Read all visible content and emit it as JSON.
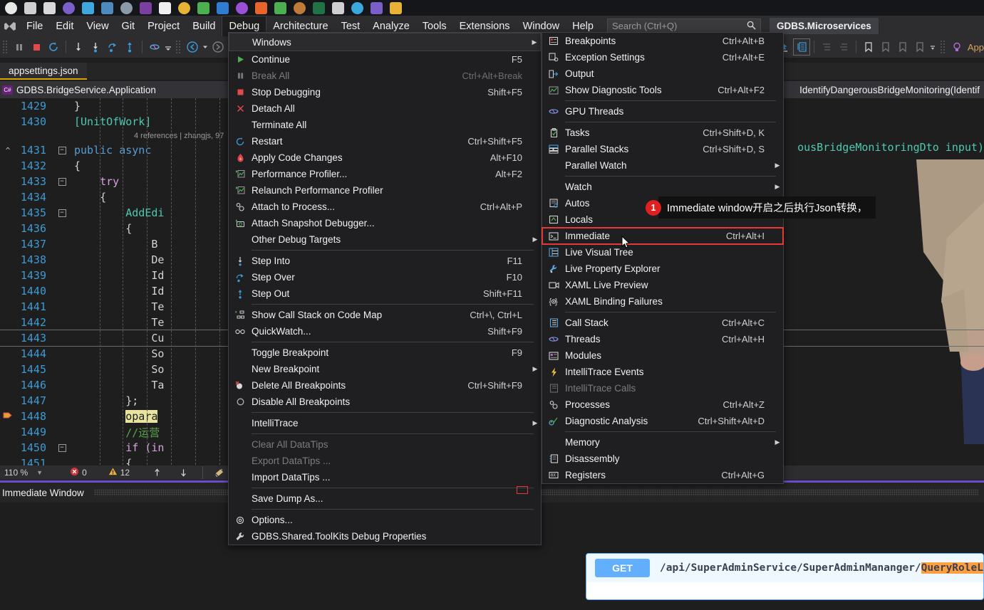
{
  "taskbar": {
    "icons": [
      {
        "name": "windows-start-icon",
        "color": "#e8e8e8"
      },
      {
        "name": "wrench-icon",
        "color": "#cfcfcf"
      },
      {
        "name": "ball-icon",
        "color": "#d8d8d8"
      },
      {
        "name": "navicat-icon",
        "color": "#7b5ec7"
      },
      {
        "name": "browser-icon",
        "color": "#3fa7dd"
      },
      {
        "name": "python-icon",
        "color": "#4b8bbe"
      },
      {
        "name": "explorer-icon",
        "color": "#8a9aa8"
      },
      {
        "name": "viber-icon",
        "color": "#7b3fa0"
      },
      {
        "name": "notepad-icon",
        "color": "#f0f0f0"
      },
      {
        "name": "fileman-icon",
        "color": "#e8b335"
      },
      {
        "name": "chrome-icon",
        "color": "#4caf50"
      },
      {
        "name": "vscode-icon",
        "color": "#2f7dd1"
      },
      {
        "name": "visualstudio-icon",
        "color": "#9b4fd6"
      },
      {
        "name": "firefox-icon",
        "color": "#e8642a"
      },
      {
        "name": "wechat-icon",
        "color": "#4cb050"
      },
      {
        "name": "photo-icon",
        "color": "#c07a3a"
      },
      {
        "name": "excel-icon",
        "color": "#217346"
      },
      {
        "name": "disc-icon",
        "color": "#cfcfcf"
      },
      {
        "name": "azure-icon",
        "color": "#3ba8dd"
      },
      {
        "name": "app-icon",
        "color": "#7b5ec7"
      },
      {
        "name": "opera-icon",
        "color": "#e8b335"
      }
    ]
  },
  "menubar": {
    "items": [
      "File",
      "Edit",
      "View",
      "Git",
      "Project",
      "Build",
      "Debug",
      "Architecture",
      "Test",
      "Analyze",
      "Tools",
      "Extensions",
      "Window",
      "Help"
    ],
    "active": "Debug",
    "search_placeholder": "Search (Ctrl+Q)",
    "solution_title": "GDBS.Microservices"
  },
  "editor": {
    "tab_label": "appsettings.json",
    "breadcrumb_class": "GDBS.BridgeService.Application",
    "breadcrumb_member": "IdentifyDangerousBridgeMonitoring(Identif",
    "cs_badge": "C#",
    "reference_info": "4 references | zhangjs, 97",
    "lines": [
      {
        "no": "1429",
        "code": "}",
        "indent": 3,
        "fold": ""
      },
      {
        "no": "1430",
        "code": "[UnitOfWork]",
        "indent": 3,
        "fold": "",
        "cls": "attr"
      },
      {
        "no": "",
        "code": "4 references | zhangjs, 97",
        "ref": true
      },
      {
        "no": "1431",
        "code": "public async ",
        "indent": 3,
        "fold": "-",
        "kw": true,
        "marker": "^"
      },
      {
        "no": "1432",
        "code": "{",
        "indent": 3,
        "fold": ""
      },
      {
        "no": "1433",
        "code": "try",
        "indent": 4,
        "fold": "-",
        "ctrl": true
      },
      {
        "no": "1434",
        "code": "{",
        "indent": 4,
        "fold": ""
      },
      {
        "no": "1435",
        "code": "AddEdi",
        "indent": 5,
        "fold": "-",
        "typ": true
      },
      {
        "no": "1436",
        "code": "{",
        "indent": 5,
        "fold": ""
      },
      {
        "no": "1437",
        "code": "B",
        "indent": 6,
        "fold": ""
      },
      {
        "no": "1438",
        "code": "De",
        "indent": 6,
        "fold": ""
      },
      {
        "no": "1439",
        "code": "Id",
        "indent": 6,
        "fold": ""
      },
      {
        "no": "1440",
        "code": "Id",
        "indent": 6,
        "fold": ""
      },
      {
        "no": "1441",
        "code": "Te",
        "indent": 6,
        "fold": ""
      },
      {
        "no": "1442",
        "code": "Te",
        "indent": 6,
        "fold": ""
      },
      {
        "no": "1443",
        "code": "Cu",
        "indent": 6,
        "fold": "",
        "current": true
      },
      {
        "no": "1444",
        "code": "So",
        "indent": 6,
        "fold": ""
      },
      {
        "no": "1445",
        "code": "So",
        "indent": 6,
        "fold": ""
      },
      {
        "no": "1446",
        "code": "Ta",
        "indent": 6,
        "fold": ""
      },
      {
        "no": "1447",
        "code": "};",
        "indent": 5,
        "fold": ""
      },
      {
        "no": "1448",
        "code": "opara",
        "indent": 5,
        "fold": "",
        "hilite": true,
        "bp": true
      },
      {
        "no": "1449",
        "code": "//运营",
        "indent": 5,
        "fold": "",
        "cmt": true
      },
      {
        "no": "1450",
        "code": "if (in",
        "indent": 5,
        "fold": "-",
        "ctrl": true
      },
      {
        "no": "1451",
        "code": "{",
        "indent": 5,
        "fold": ""
      }
    ],
    "right_code": "ousBridgeMonitoringDto input)"
  },
  "statusbar": {
    "zoom": "110 %",
    "error_count": "0",
    "warning_count": "12"
  },
  "immediate": {
    "title": "Immediate Window"
  },
  "swagger": {
    "method": "GET",
    "path_prefix": "/api/SuperAdminService/SuperAdminMananger/",
    "path_highlight": "QueryRoleL"
  },
  "callout": {
    "number": "1",
    "text": "Immediate window开启之后执行Json转换，"
  },
  "debug_menu": {
    "items": [
      {
        "label": "Windows",
        "key": "",
        "icon": "",
        "arrow": true,
        "selected": true
      },
      {
        "label": "Continue",
        "key": "F5",
        "icon": "play-icon"
      },
      {
        "label": "Break All",
        "key": "Ctrl+Alt+Break",
        "icon": "pause-icon",
        "dim": true
      },
      {
        "label": "Stop Debugging",
        "key": "Shift+F5",
        "icon": "stop-icon"
      },
      {
        "label": "Detach All",
        "key": "",
        "icon": "x-icon"
      },
      {
        "label": "Terminate All",
        "key": "",
        "icon": ""
      },
      {
        "label": "Restart",
        "key": "Ctrl+Shift+F5",
        "icon": "restart-icon"
      },
      {
        "label": "Apply Code Changes",
        "key": "Alt+F10",
        "icon": "flame-icon"
      },
      {
        "label": "Performance Profiler...",
        "key": "Alt+F2",
        "icon": "profiler-icon"
      },
      {
        "label": "Relaunch Performance Profiler",
        "key": "",
        "icon": "profiler-icon"
      },
      {
        "label": "Attach to Process...",
        "key": "Ctrl+Alt+P",
        "icon": "gears-icon"
      },
      {
        "label": "Attach Snapshot Debugger...",
        "key": "",
        "icon": "camera-icon"
      },
      {
        "label": "Other Debug Targets",
        "key": "",
        "icon": "",
        "arrow": true
      },
      {
        "sep": true
      },
      {
        "label": "Step Into",
        "key": "F11",
        "icon": "step-into-icon"
      },
      {
        "label": "Step Over",
        "key": "F10",
        "icon": "step-over-icon"
      },
      {
        "label": "Step Out",
        "key": "Shift+F11",
        "icon": "step-out-icon"
      },
      {
        "sep": true
      },
      {
        "label": "Show Call Stack on Code Map",
        "key": "Ctrl+\\, Ctrl+L",
        "icon": "codemap-icon"
      },
      {
        "label": "QuickWatch...",
        "key": "Shift+F9",
        "icon": "glasses-icon"
      },
      {
        "sep": true
      },
      {
        "label": "Toggle Breakpoint",
        "key": "F9",
        "icon": ""
      },
      {
        "label": "New Breakpoint",
        "key": "",
        "icon": "",
        "arrow": true
      },
      {
        "label": "Delete All Breakpoints",
        "key": "Ctrl+Shift+F9",
        "icon": "delete-bp-icon"
      },
      {
        "label": "Disable All Breakpoints",
        "key": "",
        "icon": "disable-bp-icon"
      },
      {
        "sep": true
      },
      {
        "label": "IntelliTrace",
        "key": "",
        "icon": "",
        "arrow": true
      },
      {
        "sep": true
      },
      {
        "label": "Clear All DataTips",
        "key": "",
        "icon": "",
        "dim": true
      },
      {
        "label": "Export DataTips ...",
        "key": "",
        "icon": "",
        "dim": true
      },
      {
        "label": "Import DataTips ...",
        "key": "",
        "icon": ""
      },
      {
        "sep": true
      },
      {
        "label": "Save Dump As...",
        "key": "",
        "icon": ""
      },
      {
        "sep": true
      },
      {
        "label": "Options...",
        "key": "",
        "icon": "gear-icon"
      },
      {
        "label": "GDBS.Shared.ToolKits Debug Properties",
        "key": "",
        "icon": "wrench-icon"
      }
    ]
  },
  "windows_submenu": {
    "items": [
      {
        "label": "Breakpoints",
        "key": "Ctrl+Alt+B",
        "icon": "breakpoints-icon"
      },
      {
        "label": "Exception Settings",
        "key": "Ctrl+Alt+E",
        "icon": "exception-icon"
      },
      {
        "label": "Output",
        "key": "",
        "icon": "output-icon"
      },
      {
        "label": "Show Diagnostic Tools",
        "key": "Ctrl+Alt+F2",
        "icon": "diagnostics-icon"
      },
      {
        "sep": true
      },
      {
        "label": "GPU Threads",
        "key": "",
        "icon": "threads-icon"
      },
      {
        "sep": true
      },
      {
        "label": "Tasks",
        "key": "Ctrl+Shift+D, K",
        "icon": "tasks-icon"
      },
      {
        "label": "Parallel Stacks",
        "key": "Ctrl+Shift+D, S",
        "icon": "parallel-stacks-icon"
      },
      {
        "label": "Parallel Watch",
        "key": "",
        "icon": "",
        "arrow": true
      },
      {
        "sep": true
      },
      {
        "label": "Watch",
        "key": "",
        "icon": "",
        "arrow": true
      },
      {
        "label": "Autos",
        "key": "",
        "icon": "autos-icon"
      },
      {
        "label": "Locals",
        "key": "",
        "icon": "locals-icon"
      },
      {
        "label": "Immediate",
        "key": "Ctrl+Alt+I",
        "icon": "immediate-icon",
        "framed": true
      },
      {
        "label": "Live Visual Tree",
        "key": "",
        "icon": "live-visual-tree-icon"
      },
      {
        "label": "Live Property Explorer",
        "key": "",
        "icon": "live-property-icon"
      },
      {
        "label": "XAML Live Preview",
        "key": "",
        "icon": "xaml-preview-icon"
      },
      {
        "label": "XAML Binding Failures",
        "key": "",
        "icon": "xaml-binding-icon"
      },
      {
        "sep": true
      },
      {
        "label": "Call Stack",
        "key": "Ctrl+Alt+C",
        "icon": "call-stack-icon"
      },
      {
        "label": "Threads",
        "key": "Ctrl+Alt+H",
        "icon": "threads-icon"
      },
      {
        "label": "Modules",
        "key": "",
        "icon": "modules-icon"
      },
      {
        "label": "IntelliTrace Events",
        "key": "",
        "icon": "lightning-icon"
      },
      {
        "label": "IntelliTrace Calls",
        "key": "",
        "icon": "calls-icon",
        "dim": true
      },
      {
        "label": "Processes",
        "key": "Ctrl+Alt+Z",
        "icon": "gears-icon"
      },
      {
        "label": "Diagnostic Analysis",
        "key": "Ctrl+Shift+Alt+D",
        "icon": "analysis-icon"
      },
      {
        "sep": true
      },
      {
        "label": "Memory",
        "key": "",
        "icon": "",
        "arrow": true
      },
      {
        "label": "Disassembly",
        "key": "",
        "icon": "disassembly-icon"
      },
      {
        "label": "Registers",
        "key": "Ctrl+Alt+G",
        "icon": "registers-icon"
      }
    ]
  },
  "colors": {
    "accent": "#61affe",
    "menu_bg": "#1f1f21",
    "editor_bg": "#1e1e1e",
    "highlight_red": "#e53935"
  }
}
